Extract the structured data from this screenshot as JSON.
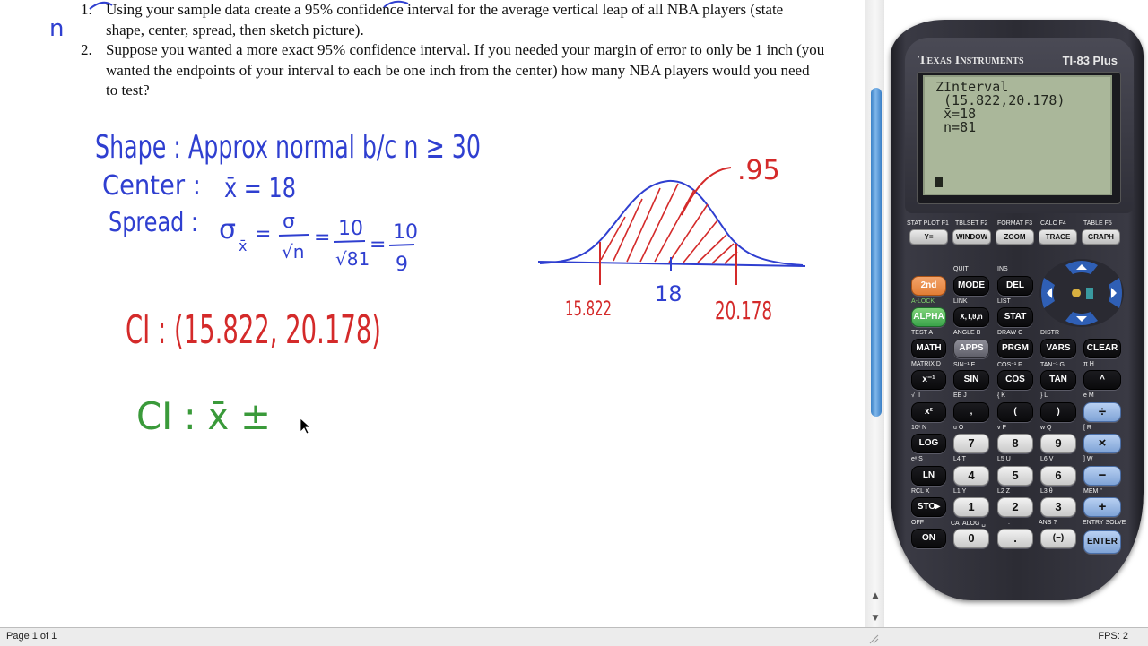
{
  "document": {
    "questions": [
      {
        "num": "1.",
        "text": "Using your sample data create a 95% confidence interval for the average vertical leap of all NBA players (state shape, center, spread, then sketch picture)."
      },
      {
        "num": "2.",
        "text": "Suppose you wanted a more exact 95% confidence interval. If you needed your margin of error to only be 1 inch (you wanted the endpoints of your interval to each be one inch from the center) how many NBA players would you need to test?"
      }
    ],
    "handwriting": {
      "margin_n": "n",
      "shape": "Shape : Approx normal b/c n ≥ 30",
      "center_label": "Center :",
      "center_value": "x̄ = 18",
      "spread_label": "Spread :",
      "spread_sigma": "σ",
      "spread_sub": "x̄",
      "spread_eq1_num": "σ",
      "spread_eq1_den": "√n",
      "spread_eq2_num": "10",
      "spread_eq2_den": "√81",
      "spread_eq3_num": "10",
      "spread_eq3_den": "9",
      "ci_red": "CI : (15.822, 20.178)",
      "ci_green": "CI : x̄ ±",
      "sketch_conf": ".95",
      "sketch_left": "15.822",
      "sketch_center": "18",
      "sketch_right": "20.178"
    },
    "ink_colors": {
      "blue": "#2f3fd0",
      "red": "#d42a2a",
      "green": "#3a9a3a"
    }
  },
  "status_bar": {
    "page": "Page 1 of 1"
  },
  "emulator": {
    "brand": "Texas Instruments",
    "model": "TI-83 Plus",
    "fps": "FPS: 2",
    "screen_lines": [
      "ZInterval",
      " (15.822,20.178)",
      " x̄=18",
      " n=81",
      "",
      "",
      ""
    ],
    "top_keys": [
      {
        "upper": "STAT PLOT",
        "fn": "F1",
        "label": "Y="
      },
      {
        "upper": "TBLSET",
        "fn": "F2",
        "label": "WINDOW"
      },
      {
        "upper": "FORMAT",
        "fn": "F3",
        "label": "ZOOM"
      },
      {
        "upper": "CALC",
        "fn": "F4",
        "label": "TRACE"
      },
      {
        "upper": "TABLE",
        "fn": "F5",
        "label": "GRAPH"
      }
    ],
    "keys": {
      "second": "2nd",
      "mode": "MODE",
      "del": "DEL",
      "alpha": "ALPHA",
      "xton": "X,T,θ,n",
      "stat": "STAT",
      "math": "MATH",
      "apps": "APPS",
      "prgm": "PRGM",
      "vars": "VARS",
      "clear": "CLEAR",
      "inv": "x⁻¹",
      "sin": "SIN",
      "cos": "COS",
      "tan": "TAN",
      "pow": "^",
      "sq": "x²",
      "comma": ",",
      "lparen": "(",
      "rparen": ")",
      "div": "÷",
      "log": "LOG",
      "k7": "7",
      "k8": "8",
      "k9": "9",
      "mul": "×",
      "ln": "LN",
      "k4": "4",
      "k5": "5",
      "k6": "6",
      "sub": "−",
      "sto": "STO▸",
      "k1": "1",
      "k2": "2",
      "k3": "3",
      "add": "+",
      "on": "ON",
      "k0": "0",
      "dot": ".",
      "neg": "(−)",
      "enter": "ENTER"
    },
    "labels": {
      "quit": "QUIT",
      "ins": "INS",
      "alock": "A-LOCK",
      "link": "LINK",
      "list": "LIST",
      "test": "TEST",
      "a": "A",
      "angle": "ANGLE",
      "b": "B",
      "draw": "DRAW",
      "c": "C",
      "distr": "DISTR",
      "matrix": "MATRIX",
      "d": "D",
      "sin1": "SIN⁻¹",
      "e": "E",
      "cos1": "COS⁻¹",
      "f": "F",
      "tan1": "TAN⁻¹",
      "g": "G",
      "pi": "π",
      "h": "H",
      "root": "√‾",
      "i": "I",
      "ee": "EE",
      "j": "J",
      "lbrace": "{",
      "k": "K",
      "rbrace": "}",
      "l": "L",
      "ee2": "e",
      "m": "M",
      "tenx": "10ˣ",
      "n": "N",
      "u": "u",
      "o": "O",
      "v": "v",
      "p": "P",
      "w": "w",
      "q": "Q",
      "lbr": "[",
      "r": "R",
      "ex": "eˣ",
      "s": "S",
      "l4": "L4",
      "t": "T",
      "l5": "L5",
      "uu": "U",
      "l6": "L6",
      "vv": "V",
      "rbr": "]",
      "ww": "W",
      "rcl": "RCL",
      "x": "X",
      "l1": "L1",
      "y": "Y",
      "l2": "L2",
      "z": "Z",
      "l3": "L3",
      "theta": "θ",
      "mem": "MEM",
      "quote": "\"",
      "off": "OFF",
      "catalog": "CATALOG",
      "space": "␣",
      "colon": ":",
      "ans": "ANS",
      "quest": "?",
      "entry": "ENTRY",
      "solve": "SOLVE"
    }
  }
}
